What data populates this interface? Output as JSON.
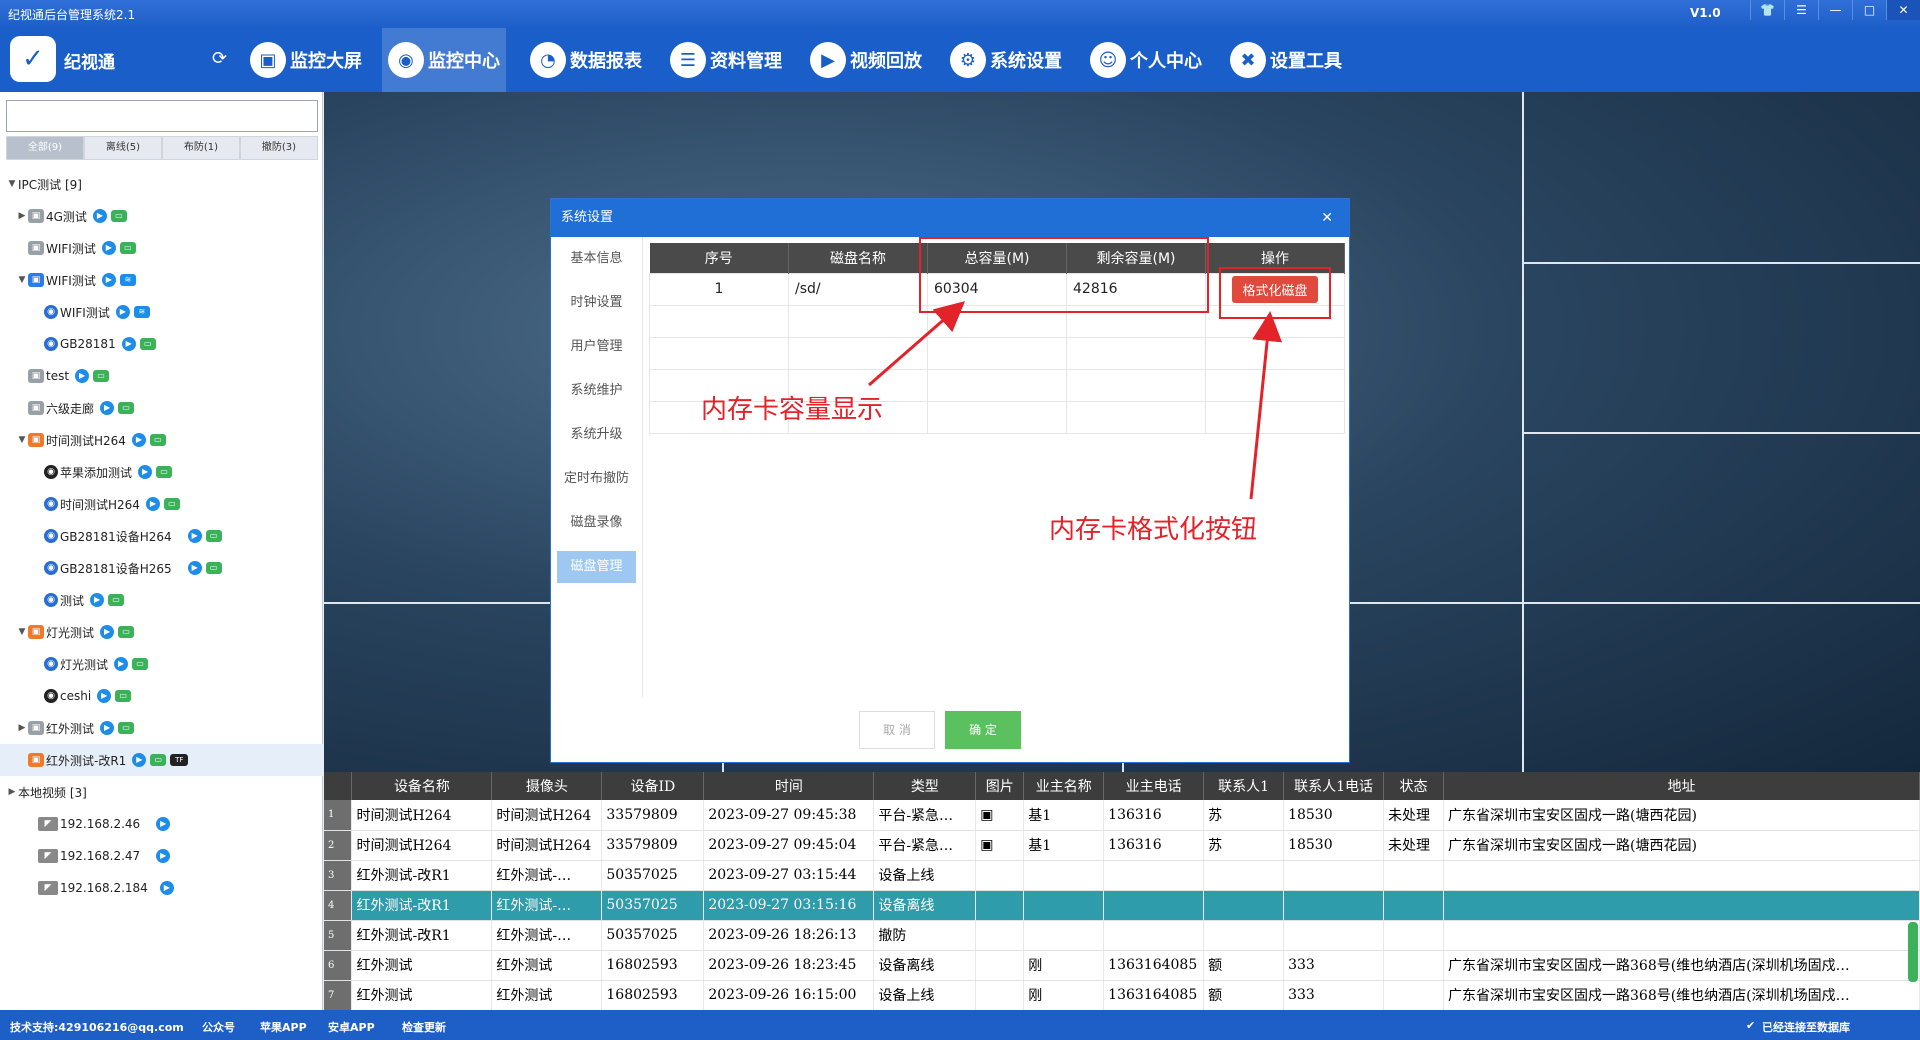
{
  "window": {
    "title": "纪视通后台管理系统2.1",
    "version": "V1.0"
  },
  "brand": {
    "name": "纪视通"
  },
  "nav": [
    {
      "label": "监控大屏",
      "icon": "monitor-icon"
    },
    {
      "label": "监控中心",
      "icon": "camera-icon"
    },
    {
      "label": "数据报表",
      "icon": "pie-chart-icon"
    },
    {
      "label": "资料管理",
      "icon": "database-icon"
    },
    {
      "label": "视频回放",
      "icon": "play-icon"
    },
    {
      "label": "系统设置",
      "icon": "gear-icon"
    },
    {
      "label": "个人中心",
      "icon": "user-icon"
    },
    {
      "label": "设置工具",
      "icon": "tools-icon"
    }
  ],
  "filters": [
    {
      "label": "全部(9)"
    },
    {
      "label": "离线(5)"
    },
    {
      "label": "布防(1)"
    },
    {
      "label": "撤防(3)"
    }
  ],
  "tree": [
    {
      "label": "IPC测试 [9]"
    },
    {
      "label": "4G测试"
    },
    {
      "label": "WIFI测试"
    },
    {
      "label": "WIFI测试"
    },
    {
      "label": "WIFI测试"
    },
    {
      "label": "GB28181"
    },
    {
      "label": "test"
    },
    {
      "label": "六级走廊"
    },
    {
      "label": "时间测试H264"
    },
    {
      "label": "苹果添加测试"
    },
    {
      "label": "时间测试H264"
    },
    {
      "label": "GB28181设备H264"
    },
    {
      "label": "GB28181设备H265"
    },
    {
      "label": "测试"
    },
    {
      "label": "灯光测试"
    },
    {
      "label": "灯光测试"
    },
    {
      "label": "ceshi"
    },
    {
      "label": "红外测试"
    },
    {
      "label": "红外测试-改R1"
    },
    {
      "label": "本地视频 [3]"
    },
    {
      "label": "192.168.2.46"
    },
    {
      "label": "192.168.2.47"
    },
    {
      "label": "192.168.2.184"
    }
  ],
  "dialog": {
    "title": "系统设置",
    "menu": [
      {
        "label": "基本信息"
      },
      {
        "label": "时钟设置"
      },
      {
        "label": "用户管理"
      },
      {
        "label": "系统维护"
      },
      {
        "label": "系统升级"
      },
      {
        "label": "定时布撤防"
      },
      {
        "label": "磁盘录像"
      },
      {
        "label": "磁盘管理"
      }
    ],
    "columns": [
      "序号",
      "磁盘名称",
      "总容量(M)",
      "剩余容量(M)",
      "操作"
    ],
    "rows": [
      {
        "no": "1",
        "name": "/sd/",
        "total": "60304",
        "free": "42816",
        "action": "格式化磁盘"
      }
    ],
    "cancel": "取 消",
    "ok": "确 定"
  },
  "annotations": {
    "capacity": "内存卡容量显示",
    "format": "内存卡格式化按钮"
  },
  "events": {
    "columns": [
      "设备名称",
      "摄像头",
      "设备ID",
      "时间",
      "类型",
      "图片",
      "业主名称",
      "业主电话",
      "联系人1",
      "联系人1电话",
      "状态",
      "地址"
    ],
    "rows": [
      {
        "idx": "1",
        "c": [
          "时间测试H264",
          "时间测试H264",
          "33579809",
          "2023-09-27 09:45:38",
          "平台-紧急…",
          "▣",
          "基1",
          "136316",
          "苏",
          "18530",
          "未处理",
          "广东省深圳市宝安区固戍一路(塘西花园)"
        ]
      },
      {
        "idx": "2",
        "c": [
          "时间测试H264",
          "时间测试H264",
          "33579809",
          "2023-09-27 09:45:04",
          "平台-紧急…",
          "▣",
          "基1",
          "136316",
          "苏",
          "18530",
          "未处理",
          "广东省深圳市宝安区固戍一路(塘西花园)"
        ]
      },
      {
        "idx": "3",
        "c": [
          "红外测试-改R1",
          "红外测试-…",
          "50357025",
          "2023-09-27 03:15:44",
          "设备上线",
          "",
          "",
          "",
          "",
          "",
          "",
          ""
        ]
      },
      {
        "idx": "4",
        "c": [
          "红外测试-改R1",
          "红外测试-…",
          "50357025",
          "2023-09-27 03:15:16",
          "设备离线",
          "",
          "",
          "",
          "",
          "",
          "",
          ""
        ]
      },
      {
        "idx": "5",
        "c": [
          "红外测试-改R1",
          "红外测试-…",
          "50357025",
          "2023-09-26 18:26:13",
          "撤防",
          "",
          "",
          "",
          "",
          "",
          "",
          ""
        ]
      },
      {
        "idx": "6",
        "c": [
          "红外测试",
          "红外测试",
          "16802593",
          "2023-09-26 18:23:45",
          "设备离线",
          "",
          "刚",
          "1363164085",
          "额",
          "333",
          "",
          "广东省深圳市宝安区固戍一路368号(维也纳酒店(深圳机场固戍…"
        ]
      },
      {
        "idx": "7",
        "c": [
          "红外测试",
          "红外测试",
          "16802593",
          "2023-09-26 16:15:00",
          "设备上线",
          "",
          "刚",
          "1363164085",
          "额",
          "333",
          "",
          "广东省深圳市宝安区固戍一路368号(维也纳酒店(深圳机场固戍…"
        ]
      }
    ]
  },
  "status": {
    "support": "技术支持:429106216@qq.com",
    "wechat": "公众号",
    "apple": "苹果APP",
    "android": "安卓APP",
    "update": "检查更新",
    "db": "已经连接至数据库"
  }
}
